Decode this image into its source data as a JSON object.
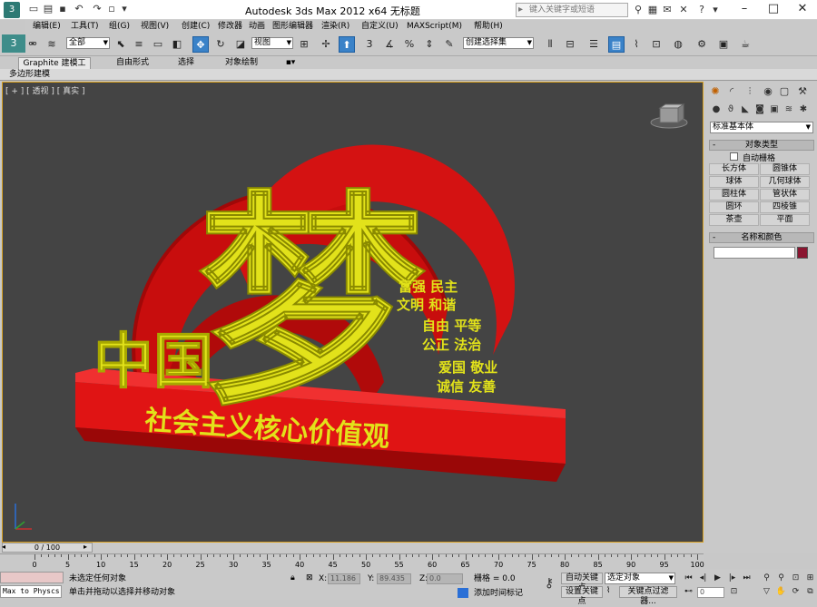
{
  "title": "Autodesk 3ds Max  2012 x64     无标题",
  "search": {
    "placeholder": "键入关键字或短语"
  },
  "menu": [
    "编辑(E)",
    "工具(T)",
    "组(G)",
    "视图(V)",
    "创建(C)",
    "修改器",
    "动画",
    "图形编辑器",
    "渲染(R)",
    "自定义(U)",
    "MAXScript(M)",
    "帮助(H)"
  ],
  "toolbar": {
    "filter_value": "全部",
    "ref_coord_value": "视图",
    "named_selection_placeholder": "创建选择集"
  },
  "ribbon": {
    "tabs": [
      "Graphite 建模工具",
      "自由形式",
      "选择",
      "对象绘制"
    ],
    "panel_label": "多边形建模"
  },
  "viewport": {
    "label": "[ + ] [ 透视 ] [ 真实 ]"
  },
  "command_panel": {
    "category_value": "标准基本体",
    "object_type_header": "对象类型",
    "autogrid_label": "自动栅格",
    "object_buttons": [
      "长方体",
      "圆锥体",
      "球体",
      "几何球体",
      "圆柱体",
      "管状体",
      "圆环",
      "四棱锥",
      "茶壶",
      "平面"
    ],
    "name_color_header": "名称和颜色",
    "object_color": "#8a1530"
  },
  "timeline": {
    "frame_label": "0 / 100",
    "ticks": [
      "0",
      "5",
      "10",
      "15",
      "20",
      "25",
      "30",
      "35",
      "40",
      "45",
      "50",
      "55",
      "60",
      "65",
      "70",
      "75",
      "80",
      "85",
      "90",
      "95",
      "100"
    ]
  },
  "status": {
    "maxscript_text": "Max to Physcs (",
    "selection_status": "未选定任何对象",
    "prompt": "单击并拖动以选择并移动对象",
    "x_label": "X:",
    "x_value": "11.186",
    "y_label": "Y:",
    "y_value": "89.435",
    "z_label": "Z:",
    "z_value": "0.0",
    "grid": "栅格 = 0.0",
    "add_time_tag": "添加时间标记",
    "auto_key": "自动关键点",
    "selected_dropdown": "选定对象",
    "set_key": "设置关键点",
    "key_filters": "关键点过滤器...",
    "frame_value": "0"
  },
  "colors": {
    "viewport_bg": "#444444",
    "sculpture_red": "#d01010",
    "sculpture_yellow": "#e2e21a",
    "active_tool": "#3a82c8"
  }
}
